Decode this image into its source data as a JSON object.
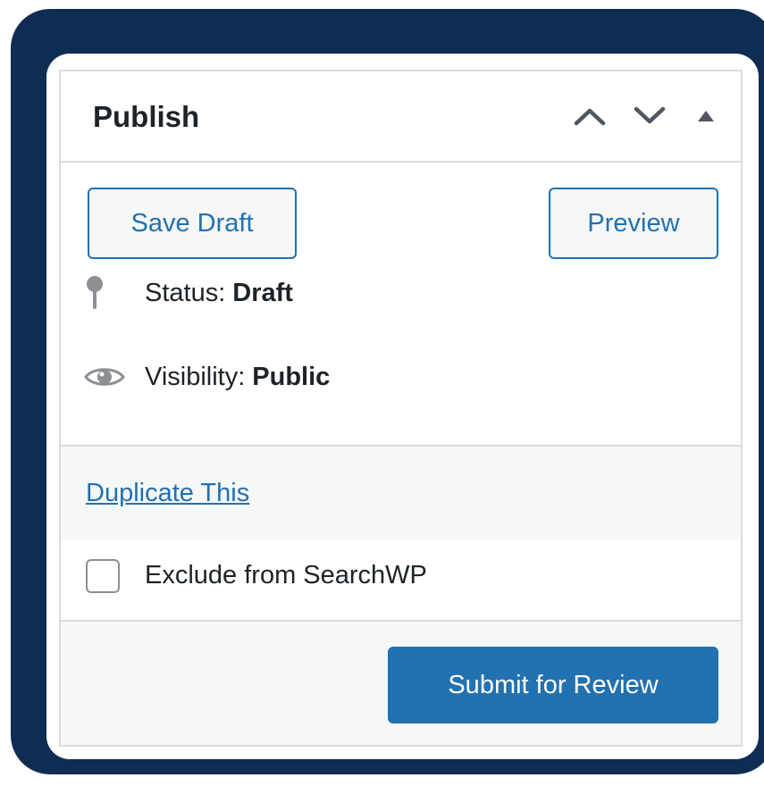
{
  "panel": {
    "title": "Publish",
    "header_icons": [
      "chevron-up-icon",
      "chevron-down-icon",
      "triangle-up-icon"
    ]
  },
  "actions": {
    "save_draft_label": "Save Draft",
    "preview_label": "Preview"
  },
  "status": {
    "icon": "pin-icon",
    "label": "Status:",
    "value": "Draft"
  },
  "visibility": {
    "icon": "eye-icon",
    "label": "Visibility:",
    "value": "Public"
  },
  "duplicate": {
    "link_label": "Duplicate This"
  },
  "exclude": {
    "label": "Exclude from SearchWP",
    "checked": false
  },
  "submit": {
    "label": "Submit for Review"
  },
  "colors": {
    "frame": "#0f2d52",
    "accent": "#2271b1",
    "text": "#1d2327",
    "border": "#dcdcde",
    "muted_bg": "#f6f7f7"
  }
}
